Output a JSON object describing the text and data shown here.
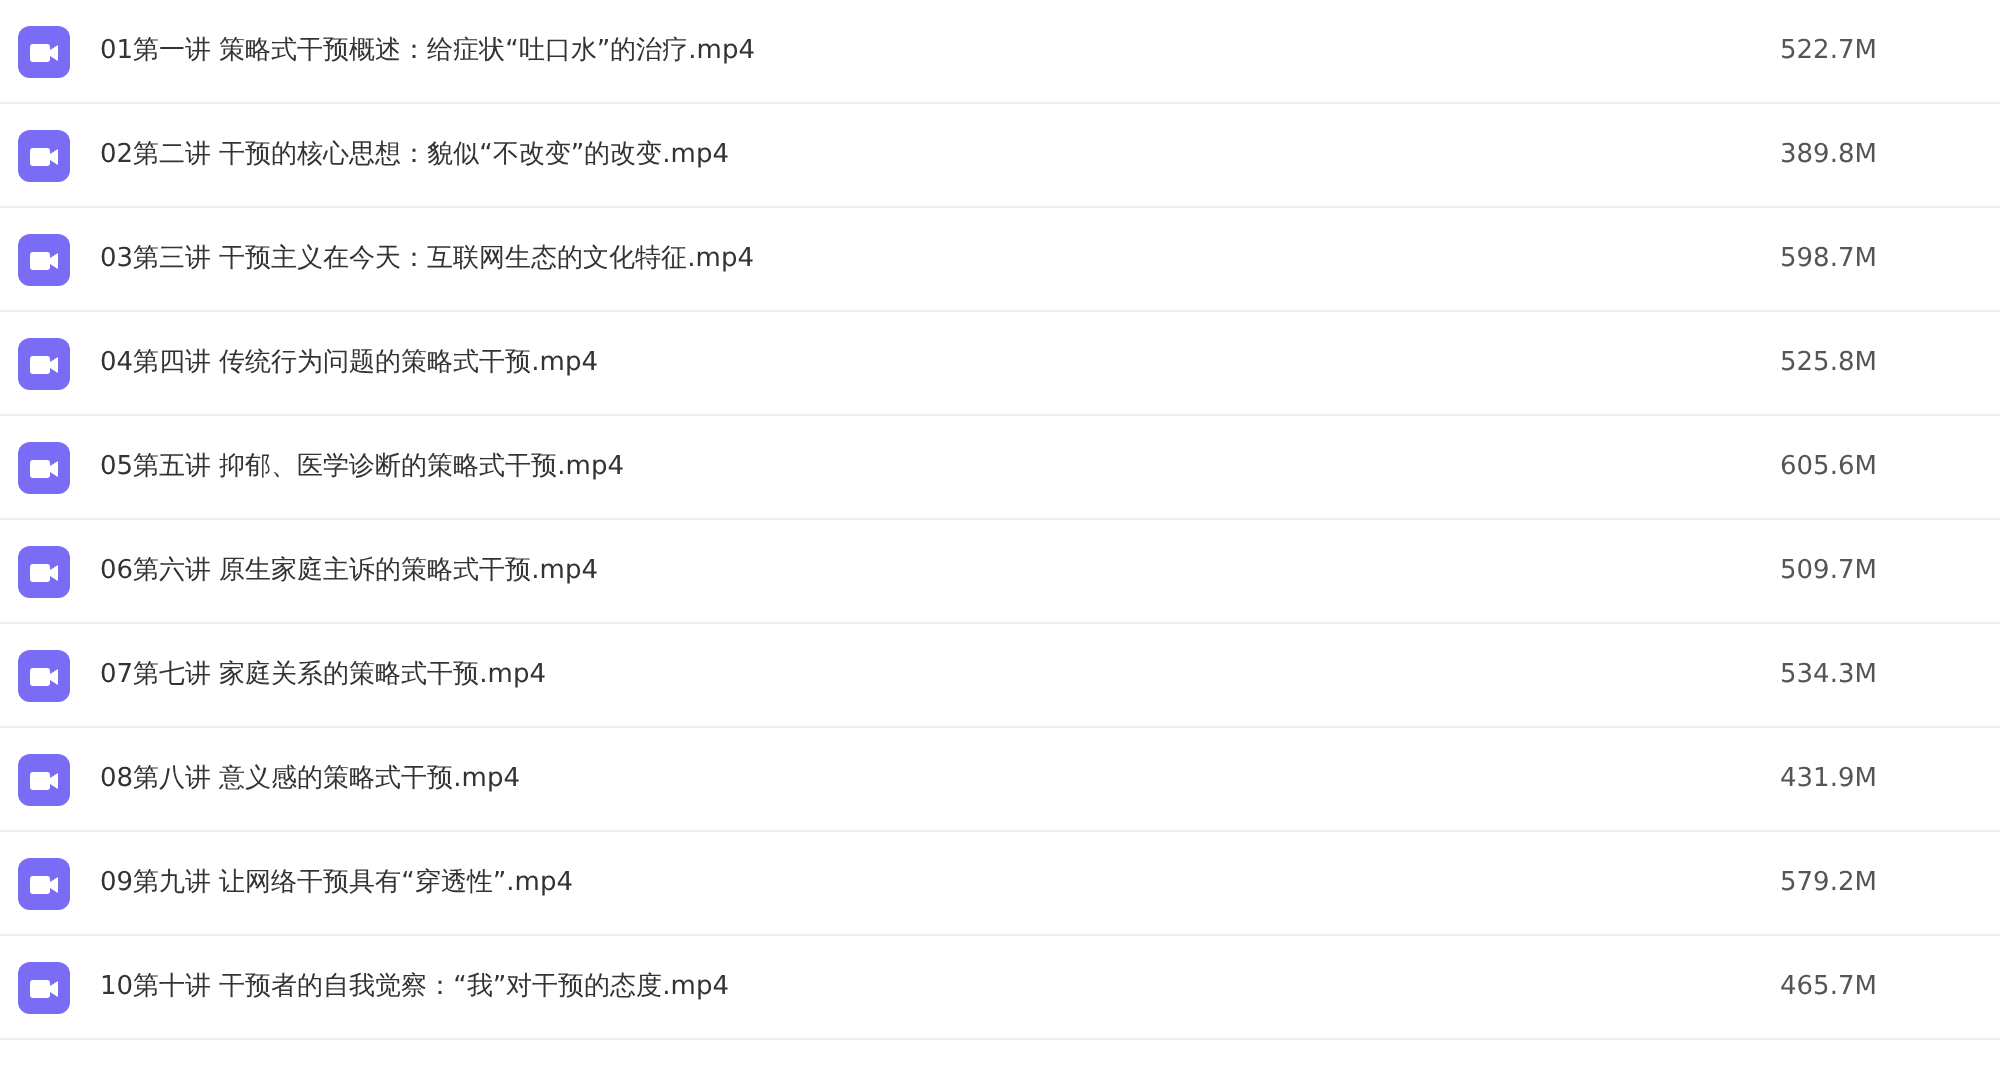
{
  "files": [
    {
      "name": "01第一讲 策略式干预概述：给症状“吐口水”的治疗.mp4",
      "size": "522.7M"
    },
    {
      "name": "02第二讲 干预的核心思想：貌似“不改变”的改变.mp4",
      "size": "389.8M"
    },
    {
      "name": "03第三讲 干预主义在今天：互联网生态的文化特征.mp4",
      "size": "598.7M"
    },
    {
      "name": "04第四讲 传统行为问题的策略式干预.mp4",
      "size": "525.8M"
    },
    {
      "name": "05第五讲 抑郁、医学诊断的策略式干预.mp4",
      "size": "605.6M"
    },
    {
      "name": "06第六讲 原生家庭主诉的策略式干预.mp4",
      "size": "509.7M"
    },
    {
      "name": "07第七讲 家庭关系的策略式干预.mp4",
      "size": "534.3M"
    },
    {
      "name": "08第八讲 意义感的策略式干预.mp4",
      "size": "431.9M"
    },
    {
      "name": "09第九讲 让网络干预具有“穿透性”.mp4",
      "size": "579.2M"
    },
    {
      "name": "10第十讲 干预者的自我觉察：“我”对干预的态度.mp4",
      "size": "465.7M"
    }
  ]
}
